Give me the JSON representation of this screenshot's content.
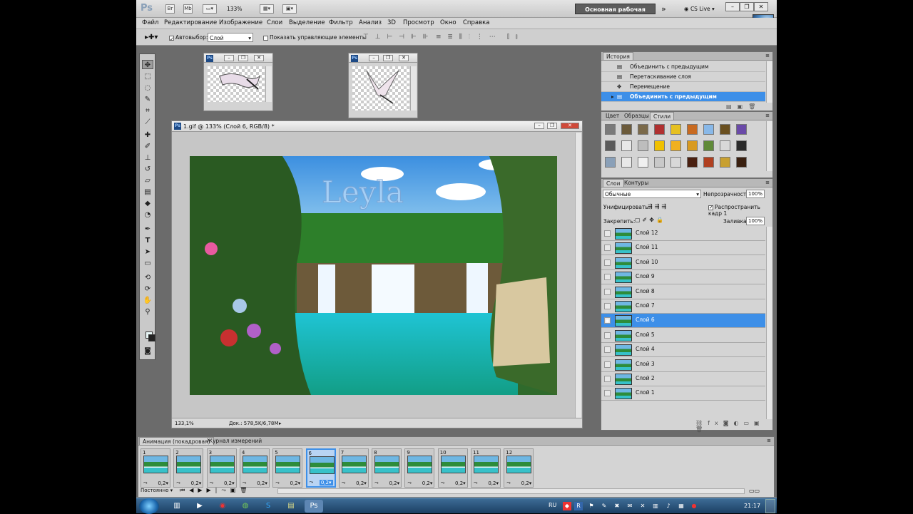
{
  "appbar": {
    "logo": "Ps",
    "app_buttons": [
      "Br",
      "Mb"
    ],
    "zoom": "133%",
    "workspace": "Основная рабочая среда",
    "cs_live": "CS Live"
  },
  "menu": [
    "Файл",
    "Редактирование",
    "Изображение",
    "Слои",
    "Выделение",
    "Фильтр",
    "Анализ",
    "3D",
    "Просмотр",
    "Окно",
    "Справка"
  ],
  "options": {
    "autoselect_label": "Автовыбор:",
    "autoselect_value": "Слой",
    "show_controls_label": "Показать управляющие элементы"
  },
  "document": {
    "title": "1.gif @ 133% (Слой 6, RGB/8) *",
    "zoom_status": "133,1%",
    "doc_status": "Док.: 578,5K/6,78M",
    "watermark": "Leyla"
  },
  "history": {
    "tab": "История",
    "items": [
      {
        "label": "Объединить с предыдущим",
        "active": false
      },
      {
        "label": "Перетаскивание слоя",
        "active": false
      },
      {
        "label": "Перемещение",
        "active": false
      },
      {
        "label": "Объединить с предыдущим",
        "active": true
      }
    ]
  },
  "styles_panel": {
    "tabs": [
      "Цвет",
      "Образцы",
      "Стили"
    ],
    "swatches": [
      "#7a7a7a",
      "#6b5a3a",
      "#7b6a4a",
      "#b03030",
      "#e6c020",
      "#c86a20",
      "#88b8e8",
      "#6a5020",
      "#6a4aa8",
      "#5a5a5a",
      "#e8e8e8",
      "#bdbdbd",
      "#f0c000",
      "#f0b020",
      "#d89a20",
      "#608a38",
      "#d8d8d8",
      "#2a2a2a",
      "#8aa0b8",
      "#e8e8e8",
      "#f0f0f0",
      "#c8c8c8",
      "#d8d8d8",
      "#4a2010",
      "#b04020",
      "#c8a030",
      "#3a2010"
    ]
  },
  "layers_panel": {
    "tabs": [
      "Слои",
      "Контуры"
    ],
    "blend_mode": "Обычные",
    "opacity_label": "Непрозрачность:",
    "opacity": "100%",
    "unify_label": "Унифицировать:",
    "propagate_label": "Распространить кадр 1",
    "lock_label": "Закрепить:",
    "fill_label": "Заливка:",
    "fill": "100%",
    "layers": [
      {
        "name": "Слой 12",
        "active": false
      },
      {
        "name": "Слой 11",
        "active": false
      },
      {
        "name": "Слой 10",
        "active": false
      },
      {
        "name": "Слой 9",
        "active": false
      },
      {
        "name": "Слой 8",
        "active": false
      },
      {
        "name": "Слой 7",
        "active": false
      },
      {
        "name": "Слой 6",
        "active": true
      },
      {
        "name": "Слой 5",
        "active": false
      },
      {
        "name": "Слой 4",
        "active": false
      },
      {
        "name": "Слой 3",
        "active": false
      },
      {
        "name": "Слой 2",
        "active": false
      },
      {
        "name": "Слой 1",
        "active": false
      }
    ]
  },
  "animation": {
    "tabs": [
      "Анимация (покадровая)",
      "Журнал измерений"
    ],
    "loop": "Постоянно",
    "frames": [
      {
        "num": "1",
        "delay": "0,2"
      },
      {
        "num": "2",
        "delay": "0,2"
      },
      {
        "num": "3",
        "delay": "0,2"
      },
      {
        "num": "4",
        "delay": "0,2"
      },
      {
        "num": "5",
        "delay": "0,2"
      },
      {
        "num": "6",
        "delay": "0,2"
      },
      {
        "num": "7",
        "delay": "0,2"
      },
      {
        "num": "8",
        "delay": "0,2"
      },
      {
        "num": "9",
        "delay": "0,2"
      },
      {
        "num": "10",
        "delay": "0,2"
      },
      {
        "num": "11",
        "delay": "0,2"
      },
      {
        "num": "12",
        "delay": "0,2"
      }
    ],
    "active_frame": 6
  },
  "taskbar": {
    "lang": "RU",
    "clock": "21:17"
  }
}
